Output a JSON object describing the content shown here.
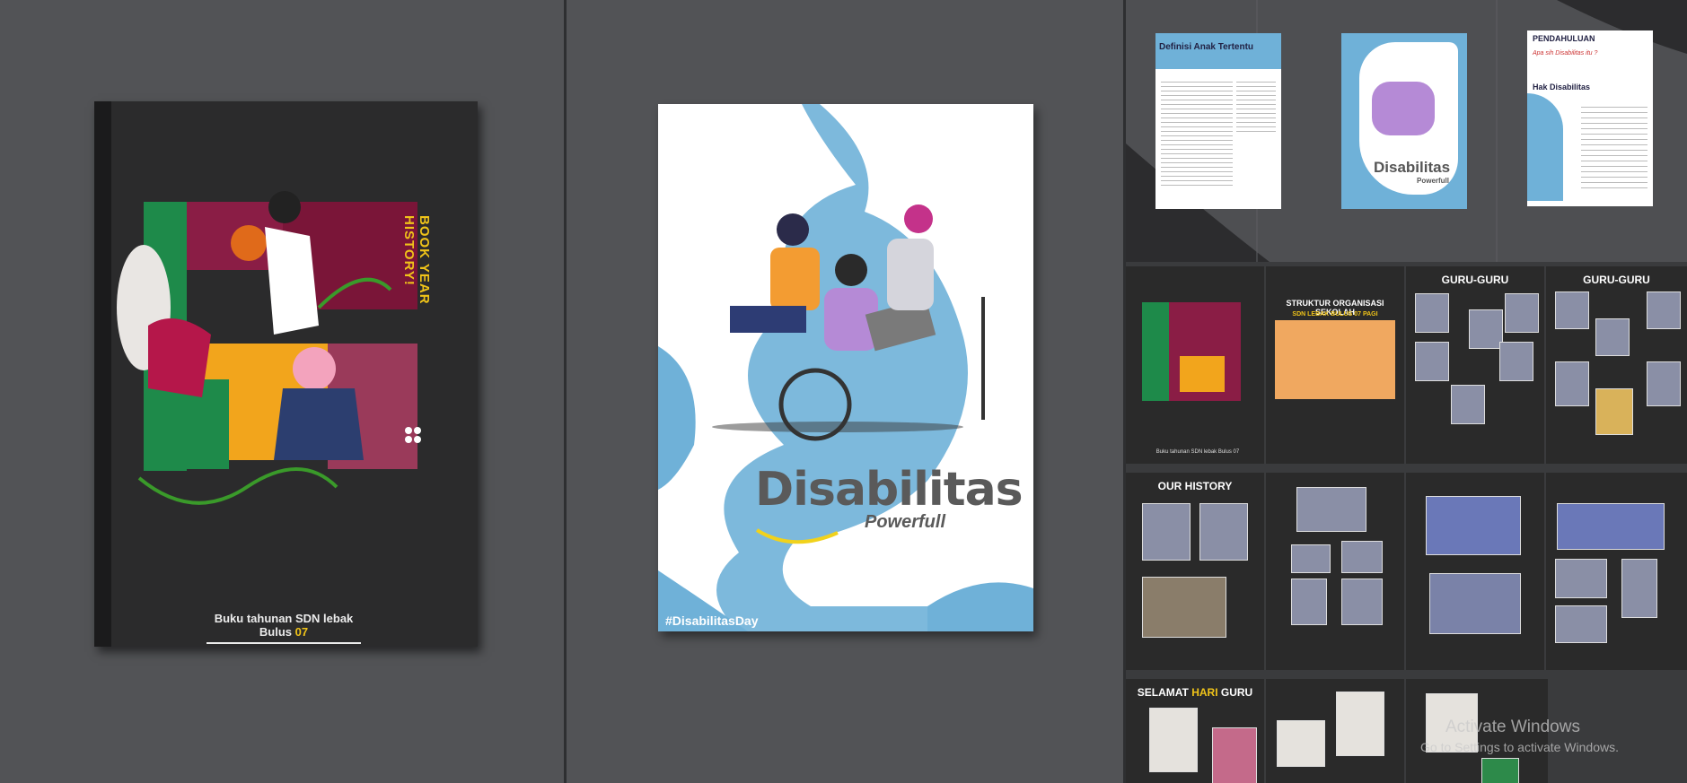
{
  "book": {
    "side_title": "BOOK YEAR HISTORY!",
    "footer_text": "Buku tahunan SDN lebak Bulus",
    "footer_number": "07"
  },
  "poster": {
    "title": "Disabilitas",
    "subtitle": "Powerfull",
    "hashtag": "#DisabilitasDay"
  },
  "thumbs": {
    "definisi_title": "Definisi Anak Tertentu",
    "pendahuluan_title": "PENDAHULUAN",
    "pendahuluan_q": "Apa sih Disabilitas itu ?",
    "hak_title": "Hak Disabilitas",
    "small_poster_title": "Disabilitas",
    "small_poster_sub": "Powerfull",
    "struktur_title": "STRUKTUR ORGANISASI SEKOLAH",
    "struktur_sub": "SDN LEBAK BULUS 07 PAGI",
    "guru1_title": "GURU-GURU",
    "guru2_title": "GURU-GURU",
    "history_title": "OUR HISTORY",
    "hari_guru_pre": "SELAMAT",
    "hari_guru_mid": "HARI",
    "hari_guru_post": "GURU",
    "small_book_footer": "Buku tahunan SDN lebak Bulus 07"
  },
  "watermark": {
    "line1": "Activate Windows",
    "line2": "Go to Settings to activate Windows."
  },
  "colors": {
    "accent_yellow": "#f0c419",
    "sky_blue": "#6fb1d8",
    "magenta": "#b5175a",
    "slide_dark": "#2a2a2a"
  }
}
